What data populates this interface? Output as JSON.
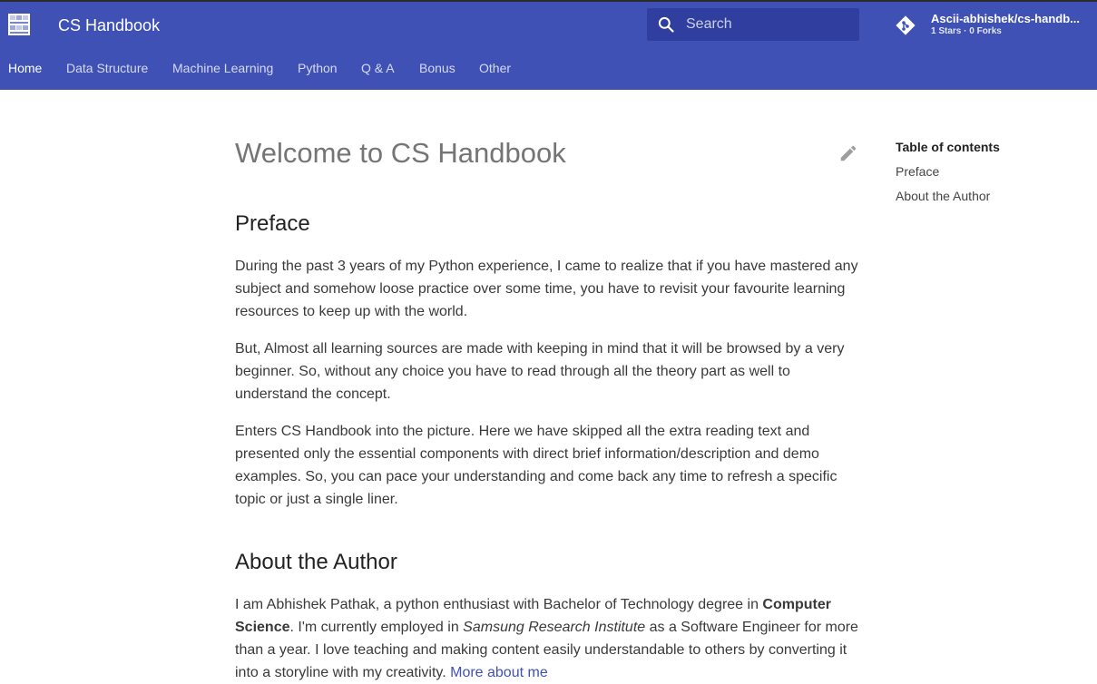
{
  "header": {
    "title": "CS Handbook",
    "accent_color": "#3f51b5",
    "search": {
      "placeholder": "Search"
    },
    "repo": {
      "name": "Ascii-abhishek/cs-handb...",
      "facts": "1 Stars · 0 Forks"
    }
  },
  "tabs": [
    {
      "label": "Home",
      "active": true
    },
    {
      "label": "Data Structure"
    },
    {
      "label": "Machine Learning"
    },
    {
      "label": "Python"
    },
    {
      "label": "Q & A"
    },
    {
      "label": "Bonus"
    },
    {
      "label": "Other"
    }
  ],
  "content": {
    "title": "Welcome to CS Handbook",
    "preface": {
      "heading": "Preface",
      "paragraphs": [
        "During the past 3 years of my Python experience, I came to realize that if you have mastered any subject and somehow loose practice over some time, you have to revisit your favourite learning resources to keep up with the world.",
        "But, Almost all learning sources are made with keeping in mind that it will be browsed by a very beginner. So, without any choice you have to read through all the theory part as well to understand the concept.",
        "Enters CS Handbook into the picture. Here we have skipped all the extra reading text and presented only the essential components with direct brief information/description and demo examples. So, you can pace your understanding and come back any time to refresh a specific topic or just a single liner."
      ]
    },
    "about": {
      "heading": "About the Author",
      "intro": "I am Abhishek Pathak, a python enthusiast with Bachelor of Technology degree in ",
      "degree": "Computer Science",
      "employed": ". I'm currently employed in ",
      "company": "Samsung Research Institute",
      "rest": " as a Software Engineer for more than a year. I love teaching and making content easily understandable to others by converting it into a storyline with my creativity. ",
      "more_link": "More about me"
    }
  },
  "toc": {
    "title": "Table of contents",
    "items": [
      "Preface",
      "About the Author"
    ]
  }
}
